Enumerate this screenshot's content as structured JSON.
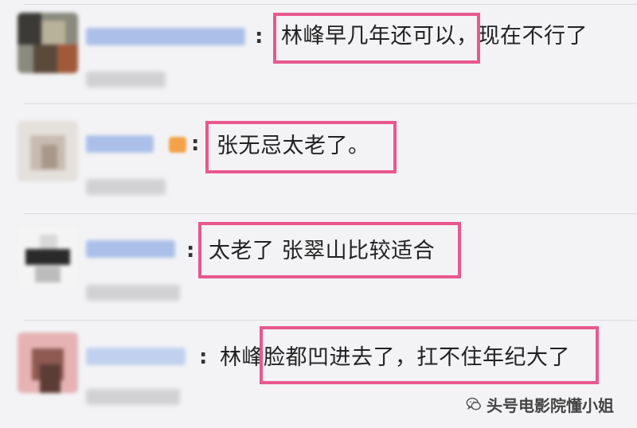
{
  "comments": [
    {
      "colon": ":",
      "text": "林峰早几年还可以，现在不行了"
    },
    {
      "colon": ":",
      "text": "张无忌太老了。"
    },
    {
      "colon": ":",
      "text": "太老了 张翠山比较适合"
    },
    {
      "colon": ":",
      "text": "林峰脸都凹进去了，扛不住年纪大了"
    }
  ],
  "colors": {
    "highlight": "#e8588e",
    "name_blue": "#9fb7e6",
    "background": "#f3f3f5"
  },
  "watermark": {
    "text": "头号电影院懂小姐",
    "icon": "wechat-icon"
  }
}
